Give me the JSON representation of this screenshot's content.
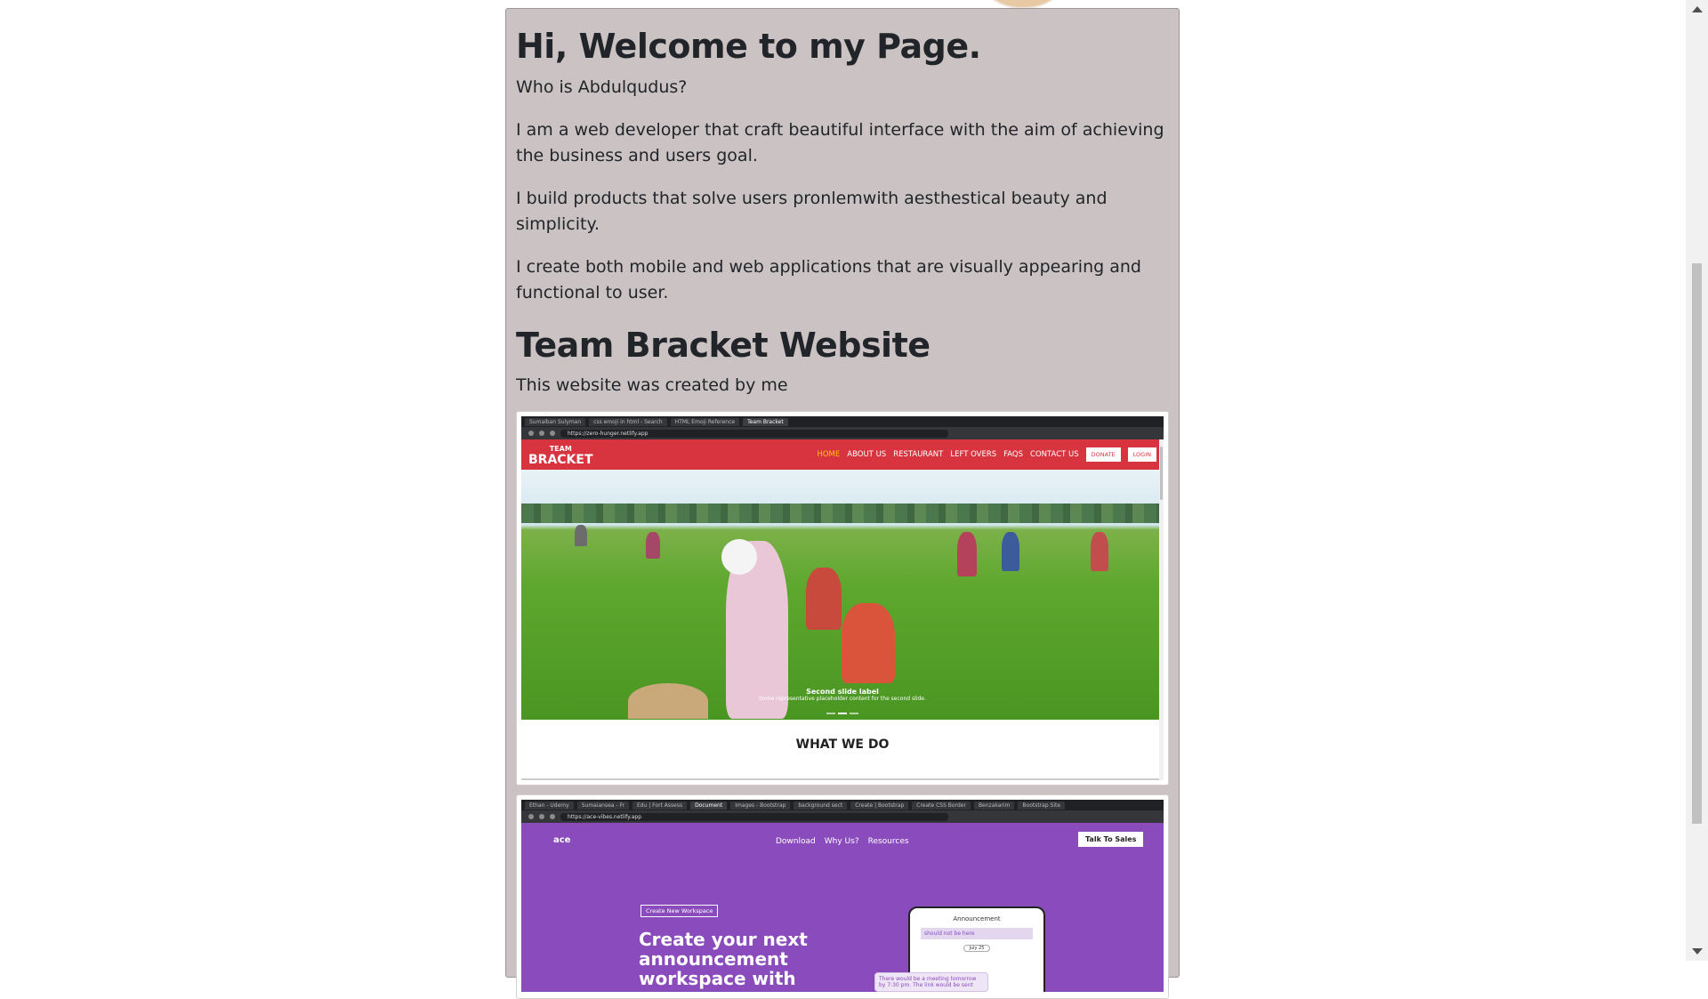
{
  "intro": {
    "heading": "Hi, Welcome to my Page.",
    "paragraphs": [
      "Who is Abdulqudus?",
      "I am a web developer that craft beautiful interface with the aim of achieving the business and users goal.",
      "I build products that solve users pronlemwith aesthestical beauty and simplicity.",
      "I create both mobile and web applications that are visually appearing and functional to user."
    ]
  },
  "project": {
    "heading": "Team Bracket Website",
    "description": "This website was created by me"
  },
  "screenshot1": {
    "tabs": [
      "Sumaiban Sulyman",
      "css emoji in html - Search",
      "HTML Emoji Reference",
      "Team Bracket"
    ],
    "url": "https://zero-hunger.netlify.app",
    "logo_top": "TEAM",
    "logo_bottom": "BRACKET",
    "nav": [
      "HOME",
      "ABOUT US",
      "RESTAURANT",
      "LEFT OVERS",
      "FAQS",
      "CONTACT US"
    ],
    "btn_donate": "DONATE",
    "btn_login": "LOGIN",
    "slide_title": "Second slide label",
    "slide_text": "Some representative placeholder content for the second slide.",
    "section": "WHAT WE DO"
  },
  "screenshot2": {
    "tabs": [
      "Ethan - Udemy",
      "Sumaiansea - Fr",
      "Edu | Fort Assess",
      "Document",
      "Images - Bootstrap",
      "background sect",
      "Create | Bootstrap",
      "Create CSS Border",
      "Benzakarim",
      "Bootstrap Site"
    ],
    "url": "https://ace-vibes.netlify.app",
    "logo": "ace",
    "nav": [
      "Download",
      "Why Us?",
      "Resources"
    ],
    "talk": "Talk To Sales",
    "create_button": "Create New Workspace",
    "headline": "Create your next announcement workspace with ace",
    "phone_title": "Announcement",
    "phone_note": "should not be here",
    "phone_date": "July 25",
    "phone_bubble": "There would be a meeting tomorrow by 7:30 pm. The link would be sent"
  }
}
